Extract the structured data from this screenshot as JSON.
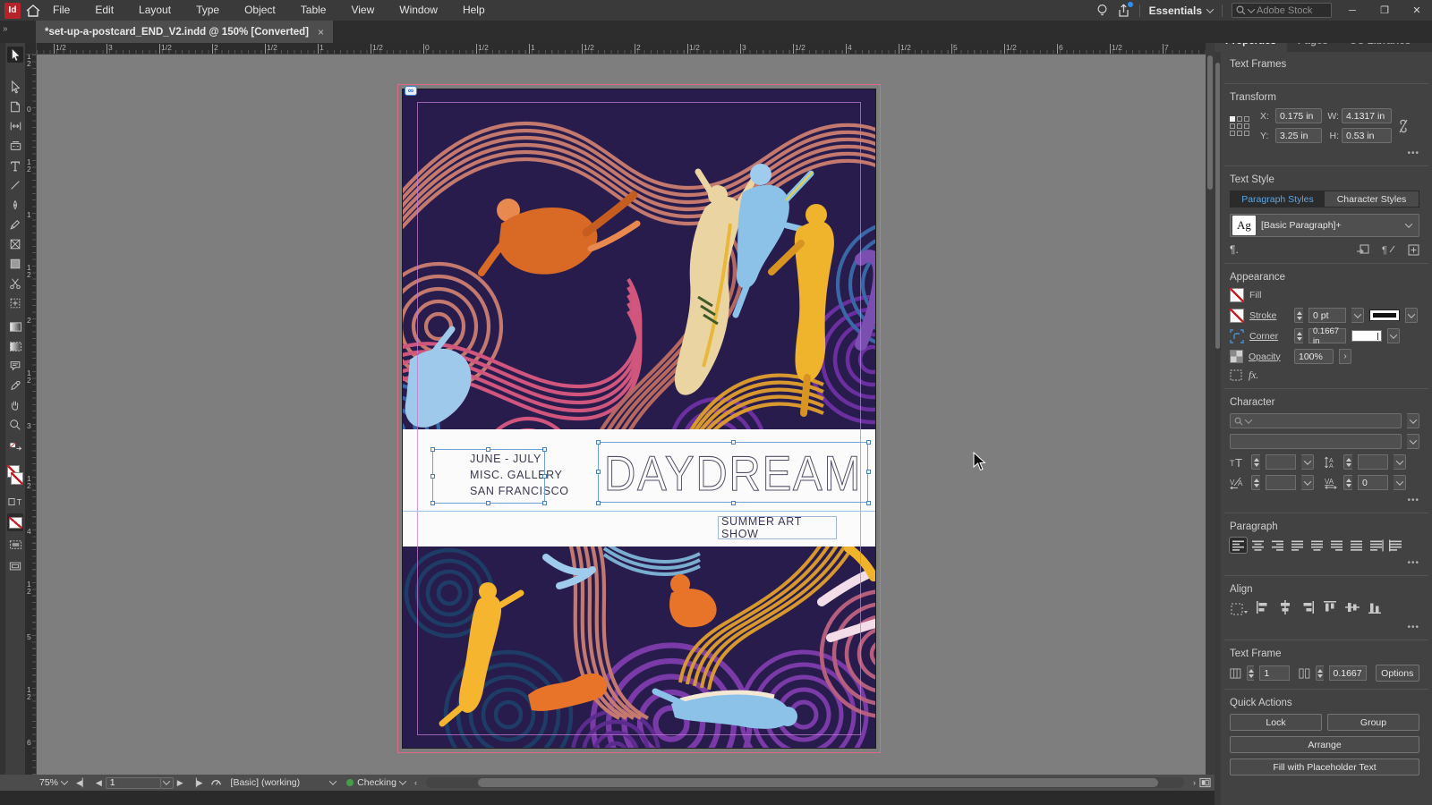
{
  "window": {
    "app_badge": "Id",
    "menus": [
      "File",
      "Edit",
      "Layout",
      "Type",
      "Object",
      "Table",
      "View",
      "Window",
      "Help"
    ],
    "workspace": "Essentials",
    "search_placeholder": "Adobe Stock",
    "collapse_glyph": "»"
  },
  "document_tab": {
    "title": "*set-up-a-postcard_END_V2.indd @ 150% [Converted]",
    "close_glyph": "×"
  },
  "toolbar": {
    "tools": [
      "selection-tool",
      "direct-selection-tool",
      "page-tool",
      "gap-tool",
      "content-collector-tool",
      "type-tool",
      "line-tool",
      "pen-tool",
      "pencil-tool",
      "rectangle-frame-tool",
      "rectangle-tool",
      "scissors-tool",
      "free-transform-tool",
      "gradient-swatch-tool",
      "gradient-feather-tool",
      "note-tool",
      "eyedropper-tool",
      "hand-tool",
      "zoom-tool",
      "fill-swatch-none",
      "stroke-swatch-none",
      "formatting-container",
      "formatting-text",
      "apply-none",
      "screen-mode",
      "preview-mode"
    ]
  },
  "rulers": {
    "top": [
      "1/2",
      "3",
      "1/2",
      "2",
      "1/2",
      "1",
      "1/2",
      "0",
      "1/2",
      "1",
      "1/2",
      "2",
      "1/2",
      "3",
      "1/2",
      "4",
      "1/2",
      "5",
      "1/2",
      "6",
      "1/2",
      "7"
    ],
    "left": [
      "1/2",
      "0",
      "1/2",
      "1",
      "1/2",
      "2",
      "1/2",
      "3",
      "1/2",
      "4",
      "1/2",
      "5",
      "1/2",
      "6"
    ]
  },
  "canvas": {
    "postcard": {
      "dates": "JUNE - JULY",
      "venue": "MISC. GALLERY",
      "city": "SAN FRANCISCO",
      "title": "DAYDREAM",
      "subtitle": "SUMMER ART SHOW"
    },
    "link_badge_glyph": "∞"
  },
  "properties_panel": {
    "tabs": [
      "Properties",
      "Pages",
      "CC Libraries"
    ],
    "selection_type": "Text Frames",
    "more_glyph": "•••",
    "transform": {
      "title": "Transform",
      "x_label": "X:",
      "x": "0.175 in",
      "y_label": "Y:",
      "y": "3.25 in",
      "w_label": "W:",
      "w": "4.1317 in",
      "h_label": "H:",
      "h": "0.53 in"
    },
    "text_style": {
      "title": "Text Style",
      "tabs": [
        "Paragraph Styles",
        "Character Styles"
      ],
      "style_sample": "Ag",
      "style_name": "[Basic Paragraph]+",
      "pilcrow": "¶."
    },
    "appearance": {
      "title": "Appearance",
      "fill_label": "Fill",
      "stroke_label": "Stroke",
      "stroke_value": "0 pt",
      "corner_label": "Corner",
      "corner_value": "0.1667 in",
      "opacity_label": "Opacity",
      "opacity_value": "100%",
      "opacity_more": "›",
      "fx_label": "fx."
    },
    "character": {
      "title": "Character",
      "tracking_value": "0"
    },
    "paragraph": {
      "title": "Paragraph"
    },
    "align": {
      "title": "Align"
    },
    "text_frame": {
      "title": "Text Frame",
      "columns_value": "1",
      "gutter_value": "0.1667",
      "options_label": "Options"
    },
    "quick_actions": {
      "title": "Quick Actions",
      "buttons": [
        "Lock",
        "Group",
        "Arrange",
        "Fill with Placeholder Text"
      ]
    }
  },
  "status_bar": {
    "zoom": "75%",
    "page": "1",
    "first_glyph": "◀▏",
    "prev_glyph": "◀",
    "next_glyph": "▶",
    "last_glyph": "▕▶",
    "preset": "[Basic] (working)",
    "preflight_status": "Checking",
    "scroll_left_glyph": "‹",
    "scroll_right_glyph": "›"
  },
  "colors": {
    "accent_blue": "#5aa7e8",
    "selection_blue": "#6fa1d4",
    "margin_guide": "#c27ad6",
    "bleed_guide": "#e06a86",
    "preflight_ok": "#43a047",
    "art_background": "#281c4d"
  }
}
